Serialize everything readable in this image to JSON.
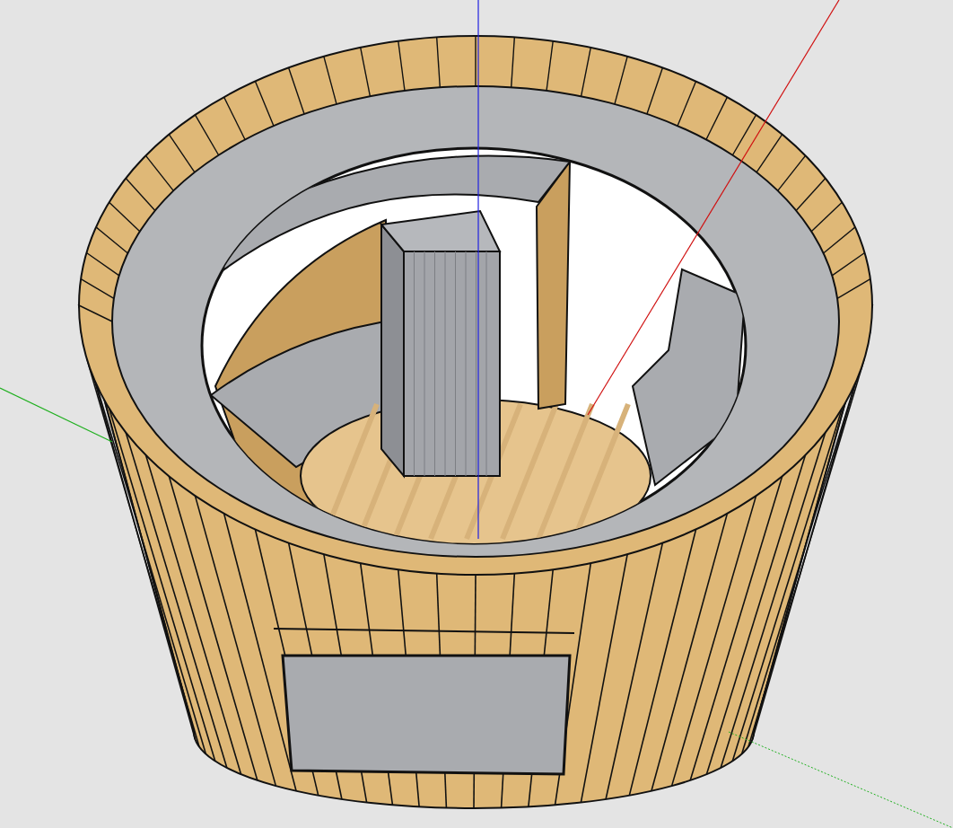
{
  "viewport": {
    "kind": "model"
  }
}
